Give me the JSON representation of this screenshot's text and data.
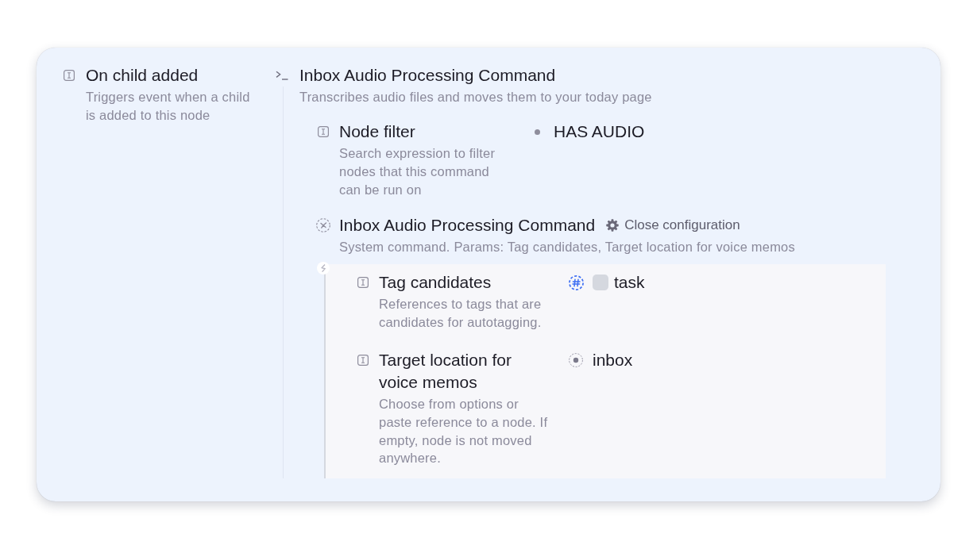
{
  "trigger": {
    "title": "On child added",
    "description": "Triggers event when a child is added to this node"
  },
  "command": {
    "title": "Inbox Audio Processing Command",
    "description": "Transcribes audio files and moves them to your today page",
    "fields": [
      {
        "label": "Node filter",
        "description": "Search expression to filter nodes that this command can be run on",
        "value": {
          "kind": "search",
          "text": "HAS AUDIO"
        }
      }
    ],
    "system_command": {
      "title": "Inbox Audio Processing Command",
      "config_button": "Close configuration",
      "description": "System command. Params: Tag candidates, Target location for voice memos",
      "params": [
        {
          "label": "Tag candidates",
          "description": "References to tags that are candidates for autotagging.",
          "value": {
            "kind": "tag",
            "text": "task",
            "checked": false
          }
        },
        {
          "label": "Target location for voice memos",
          "description": "Choose from options or paste reference to a node. If empty, node is not moved anywhere.",
          "value": {
            "kind": "node",
            "text": "inbox"
          }
        }
      ]
    }
  }
}
